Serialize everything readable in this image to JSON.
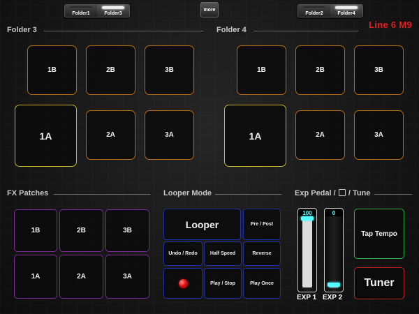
{
  "topbar": {
    "left_switch": [
      "Folder1",
      "Folder3"
    ],
    "right_switch": [
      "Folder2",
      "Folder4"
    ],
    "more_label": "more",
    "brand": "Line 6 M9"
  },
  "folder3": {
    "title": "Folder 3",
    "pads": [
      "1B",
      "2B",
      "3B",
      "1A",
      "2A",
      "3A"
    ]
  },
  "folder4": {
    "title": "Folder 4",
    "pads": [
      "1B",
      "2B",
      "3B",
      "1A",
      "2A",
      "3A"
    ]
  },
  "fx": {
    "title": "FX Patches",
    "pads": [
      "1B",
      "2B",
      "3B",
      "1A",
      "2A",
      "3A"
    ]
  },
  "looper": {
    "title": "Looper Mode",
    "looper_label": "Looper",
    "pre_post": "Pre / Post",
    "undo_redo": "Undo / Redo",
    "half_speed": "Half Speed",
    "reverse": "Reverse",
    "play_stop": "Play / Stop",
    "play_once": "Play Once"
  },
  "exp": {
    "title_a": "Exp Pedal /",
    "title_b": "/ Tune",
    "pedal1": {
      "value": "100",
      "label": "EXP 1",
      "level": 1.0
    },
    "pedal2": {
      "value": "0",
      "label": "EXP 2",
      "level": 0.0
    },
    "tap_tempo": "Tap Tempo",
    "tuner": "Tuner"
  },
  "colors": {
    "folder_outline": "#b86a10",
    "active_outline": "#c9b820",
    "fx_outline": "#7b2a9c",
    "looper_outline": "#1f2fa6",
    "tap_tempo_outline": "#2fb24a",
    "tuner_outline": "#c02020",
    "brand": "#e41c1c",
    "exp_handle": "#55ffff"
  }
}
